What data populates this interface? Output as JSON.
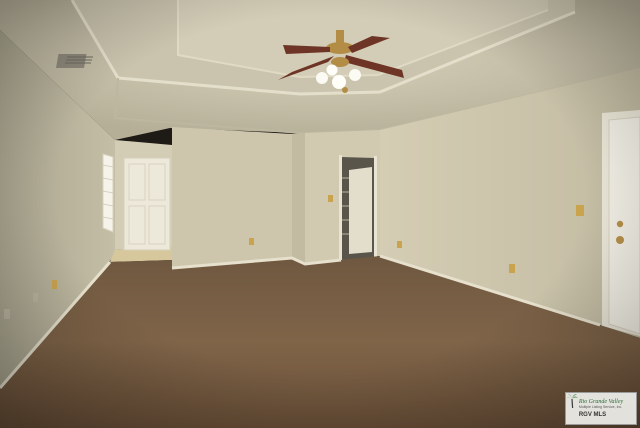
{
  "scene": {
    "description_tag": "empty-room-photo",
    "colors": {
      "wall": "#cfc8b0",
      "ceiling": "#c9c3ad",
      "carpet": "#7d6347",
      "baseboard": "#e6e0cc",
      "fan_blade": "#6e3526",
      "fan_metal": "#b38c45"
    }
  },
  "watermark": {
    "title": "Rio Grande Valley",
    "subtitle": "Multiple Listing Service, Inc.",
    "mls": "RGV MLS"
  }
}
